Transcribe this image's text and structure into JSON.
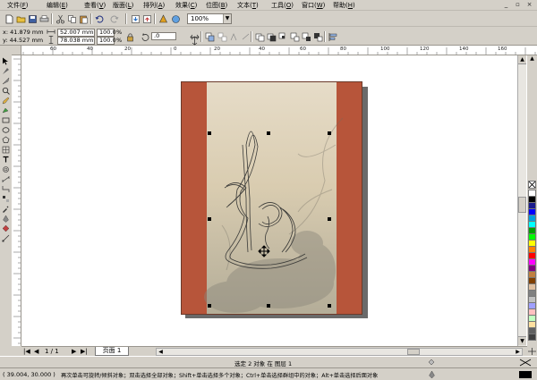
{
  "menu": [
    {
      "label": "文件",
      "key": "F"
    },
    {
      "label": "编辑",
      "key": "E"
    },
    {
      "label": "查看",
      "key": "V"
    },
    {
      "label": "版面",
      "key": "L"
    },
    {
      "label": "排列",
      "key": "A"
    },
    {
      "label": "效果",
      "key": "C"
    },
    {
      "label": "位图",
      "key": "B"
    },
    {
      "label": "文本",
      "key": "T"
    },
    {
      "label": "工具",
      "key": "O"
    },
    {
      "label": "窗口",
      "key": "W"
    },
    {
      "label": "帮助",
      "key": "H"
    }
  ],
  "window_controls": [
    "_",
    "▫",
    "×"
  ],
  "toolbar": {
    "zoom_value": "100%"
  },
  "property_bar": {
    "x_label": "x:",
    "x_value": "41.879 mm",
    "y_label": "y:",
    "y_value": "44.527 mm",
    "width_value": "52.007 mm",
    "height_value": "78.038 mm",
    "scale_x": "100.0",
    "scale_y": "100.0",
    "scale_unit": "%",
    "rotation": ".0"
  },
  "ruler": {
    "top_ticks": [
      "60",
      "40",
      "20",
      "0",
      "20",
      "40",
      "60",
      "80",
      "100",
      "120",
      "140",
      "160",
      "180"
    ],
    "left_ticks": [
      "260",
      "240",
      "220",
      "200",
      "180",
      "160",
      "140",
      "120",
      "100",
      "80",
      "60",
      "40",
      "20"
    ],
    "unit": "毫米"
  },
  "page_nav": {
    "counter": "1 / 1",
    "tab_label": "页面 1"
  },
  "status": {
    "selection_text": "选定 2 对象 在 图层 1",
    "coordinates": "( 39.004, 30.000 )",
    "hint_text": "再次单击可旋转/倾斜对象；双击选择全部对象；Shift+单击选择多个对象；Ctrl+单击选择群组中的对象；Alt+单击选择后面对象"
  },
  "palette_colors": [
    "#ffffff",
    "#000000",
    "#1a1a8c",
    "#0000ff",
    "#00a0e0",
    "#00ffff",
    "#00a000",
    "#00ff00",
    "#ffff00",
    "#ff8000",
    "#ff0000",
    "#ff00ff",
    "#800080",
    "#c08040",
    "#804000",
    "#e0c0a0",
    "#808080",
    "#c0c0c0",
    "#a0a0ff",
    "#ffc0c0",
    "#c0ffc0",
    "#ffe0a0",
    "#606060",
    "#404040",
    "#202020"
  ]
}
